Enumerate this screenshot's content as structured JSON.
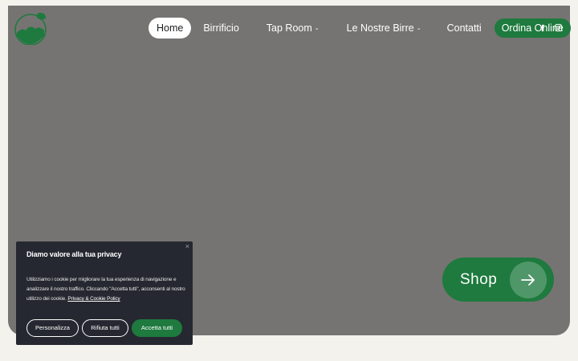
{
  "nav": {
    "items": [
      {
        "label": "Home",
        "active": true
      },
      {
        "label": "Birrificio"
      },
      {
        "label": "Tap Room",
        "dropdown": true
      },
      {
        "label": "Le Nostre Birre",
        "dropdown": true
      },
      {
        "label": "Contatti"
      }
    ],
    "cta_label": "Ordina Online",
    "caret": "⌄"
  },
  "social": {
    "icons": [
      "facebook-icon",
      "instagram-icon"
    ]
  },
  "logo": {
    "icon": "brewery-logo-icon"
  },
  "shop": {
    "label": "Shop",
    "icon": "arrow-right-icon"
  },
  "cookie": {
    "close": "×",
    "title": "Diamo valore alla tua privacy",
    "text": "Utilizziamo i cookie per migliorare la tua esperienza di navigazione e analizzare il nostro traffico. Cliccando \"Accetta tutti\", acconsenti al nostro utilizzo dei cookie.",
    "link": "Privacy & Cookie Policy",
    "buttons": {
      "customize": "Personalizza",
      "reject": "Rifiuta tutti",
      "accept": "Accetta tutti"
    }
  },
  "colors": {
    "accent": "#1e7a3e",
    "hero_bg": "#767472",
    "page_bg": "#f4f2ed",
    "cookie_bg": "#252830"
  }
}
